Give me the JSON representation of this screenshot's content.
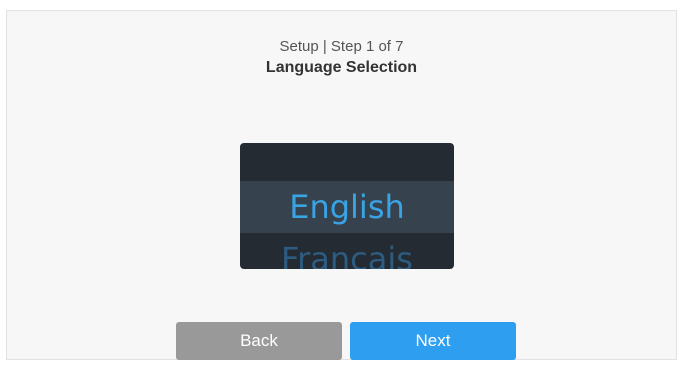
{
  "header": {
    "step_text": "Setup | Step 1 of 7",
    "title": "Language Selection"
  },
  "language_picker": {
    "selected": "English",
    "next": "Français"
  },
  "buttons": {
    "back_label": "Back",
    "next_label": "Next"
  },
  "colors": {
    "accent": "#2d9ef0",
    "picker_bg": "#252b33",
    "picker_band": "#36424d",
    "back_button": "#999999"
  }
}
